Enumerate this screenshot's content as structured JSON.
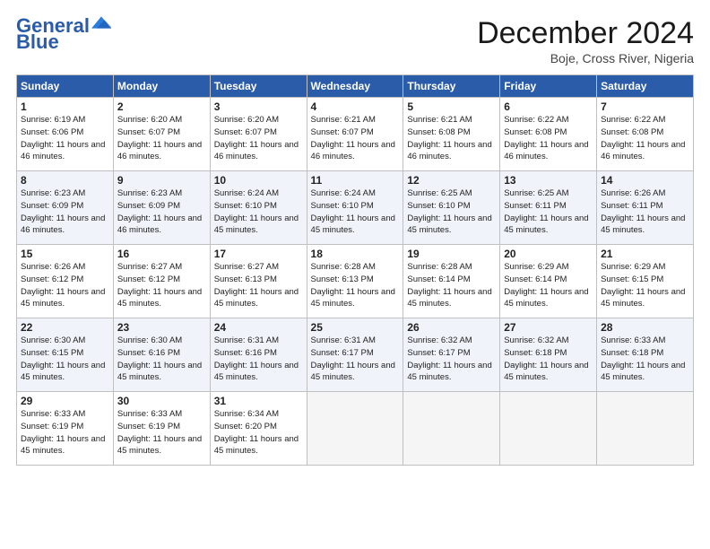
{
  "logo": {
    "line1": "General",
    "line2": "Blue"
  },
  "title": "December 2024",
  "subtitle": "Boje, Cross River, Nigeria",
  "days_of_week": [
    "Sunday",
    "Monday",
    "Tuesday",
    "Wednesday",
    "Thursday",
    "Friday",
    "Saturday"
  ],
  "weeks": [
    [
      {
        "day": 1,
        "sunrise": "6:19 AM",
        "sunset": "6:06 PM",
        "daylight": "11 hours and 46 minutes."
      },
      {
        "day": 2,
        "sunrise": "6:20 AM",
        "sunset": "6:07 PM",
        "daylight": "11 hours and 46 minutes."
      },
      {
        "day": 3,
        "sunrise": "6:20 AM",
        "sunset": "6:07 PM",
        "daylight": "11 hours and 46 minutes."
      },
      {
        "day": 4,
        "sunrise": "6:21 AM",
        "sunset": "6:07 PM",
        "daylight": "11 hours and 46 minutes."
      },
      {
        "day": 5,
        "sunrise": "6:21 AM",
        "sunset": "6:08 PM",
        "daylight": "11 hours and 46 minutes."
      },
      {
        "day": 6,
        "sunrise": "6:22 AM",
        "sunset": "6:08 PM",
        "daylight": "11 hours and 46 minutes."
      },
      {
        "day": 7,
        "sunrise": "6:22 AM",
        "sunset": "6:08 PM",
        "daylight": "11 hours and 46 minutes."
      }
    ],
    [
      {
        "day": 8,
        "sunrise": "6:23 AM",
        "sunset": "6:09 PM",
        "daylight": "11 hours and 46 minutes."
      },
      {
        "day": 9,
        "sunrise": "6:23 AM",
        "sunset": "6:09 PM",
        "daylight": "11 hours and 46 minutes."
      },
      {
        "day": 10,
        "sunrise": "6:24 AM",
        "sunset": "6:10 PM",
        "daylight": "11 hours and 45 minutes."
      },
      {
        "day": 11,
        "sunrise": "6:24 AM",
        "sunset": "6:10 PM",
        "daylight": "11 hours and 45 minutes."
      },
      {
        "day": 12,
        "sunrise": "6:25 AM",
        "sunset": "6:10 PM",
        "daylight": "11 hours and 45 minutes."
      },
      {
        "day": 13,
        "sunrise": "6:25 AM",
        "sunset": "6:11 PM",
        "daylight": "11 hours and 45 minutes."
      },
      {
        "day": 14,
        "sunrise": "6:26 AM",
        "sunset": "6:11 PM",
        "daylight": "11 hours and 45 minutes."
      }
    ],
    [
      {
        "day": 15,
        "sunrise": "6:26 AM",
        "sunset": "6:12 PM",
        "daylight": "11 hours and 45 minutes."
      },
      {
        "day": 16,
        "sunrise": "6:27 AM",
        "sunset": "6:12 PM",
        "daylight": "11 hours and 45 minutes."
      },
      {
        "day": 17,
        "sunrise": "6:27 AM",
        "sunset": "6:13 PM",
        "daylight": "11 hours and 45 minutes."
      },
      {
        "day": 18,
        "sunrise": "6:28 AM",
        "sunset": "6:13 PM",
        "daylight": "11 hours and 45 minutes."
      },
      {
        "day": 19,
        "sunrise": "6:28 AM",
        "sunset": "6:14 PM",
        "daylight": "11 hours and 45 minutes."
      },
      {
        "day": 20,
        "sunrise": "6:29 AM",
        "sunset": "6:14 PM",
        "daylight": "11 hours and 45 minutes."
      },
      {
        "day": 21,
        "sunrise": "6:29 AM",
        "sunset": "6:15 PM",
        "daylight": "11 hours and 45 minutes."
      }
    ],
    [
      {
        "day": 22,
        "sunrise": "6:30 AM",
        "sunset": "6:15 PM",
        "daylight": "11 hours and 45 minutes."
      },
      {
        "day": 23,
        "sunrise": "6:30 AM",
        "sunset": "6:16 PM",
        "daylight": "11 hours and 45 minutes."
      },
      {
        "day": 24,
        "sunrise": "6:31 AM",
        "sunset": "6:16 PM",
        "daylight": "11 hours and 45 minutes."
      },
      {
        "day": 25,
        "sunrise": "6:31 AM",
        "sunset": "6:17 PM",
        "daylight": "11 hours and 45 minutes."
      },
      {
        "day": 26,
        "sunrise": "6:32 AM",
        "sunset": "6:17 PM",
        "daylight": "11 hours and 45 minutes."
      },
      {
        "day": 27,
        "sunrise": "6:32 AM",
        "sunset": "6:18 PM",
        "daylight": "11 hours and 45 minutes."
      },
      {
        "day": 28,
        "sunrise": "6:33 AM",
        "sunset": "6:18 PM",
        "daylight": "11 hours and 45 minutes."
      }
    ],
    [
      {
        "day": 29,
        "sunrise": "6:33 AM",
        "sunset": "6:19 PM",
        "daylight": "11 hours and 45 minutes."
      },
      {
        "day": 30,
        "sunrise": "6:33 AM",
        "sunset": "6:19 PM",
        "daylight": "11 hours and 45 minutes."
      },
      {
        "day": 31,
        "sunrise": "6:34 AM",
        "sunset": "6:20 PM",
        "daylight": "11 hours and 45 minutes."
      },
      null,
      null,
      null,
      null
    ]
  ]
}
